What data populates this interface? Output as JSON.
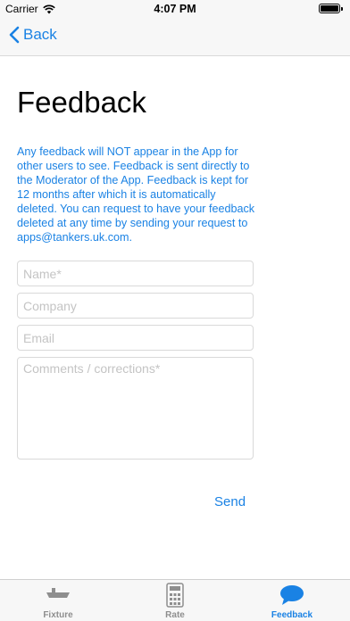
{
  "status_bar": {
    "carrier": "Carrier",
    "time": "4:07 PM"
  },
  "nav": {
    "back_label": "Back"
  },
  "page": {
    "title": "Feedback",
    "info": "Any feedback will NOT appear in the App for other users to see. Feedback is sent directly to the Moderator of the App. Feedback is kept for 12 months after which it is automatically deleted. You can request to have your feedback deleted at any time by sending your request to apps@tankers.uk.com."
  },
  "form": {
    "name_placeholder": "Name*",
    "company_placeholder": "Company",
    "email_placeholder": "Email",
    "comments_placeholder": "Comments / corrections*",
    "send_label": "Send"
  },
  "tabs": [
    {
      "label": "Fixture",
      "icon": "ship-icon",
      "active": false
    },
    {
      "label": "Rate",
      "icon": "calculator-icon",
      "active": false
    },
    {
      "label": "Feedback",
      "icon": "speech-bubble-icon",
      "active": true
    }
  ],
  "colors": {
    "accent": "#1a82e4",
    "inactive": "#8e8e8e",
    "border": "#d9d9d9"
  }
}
